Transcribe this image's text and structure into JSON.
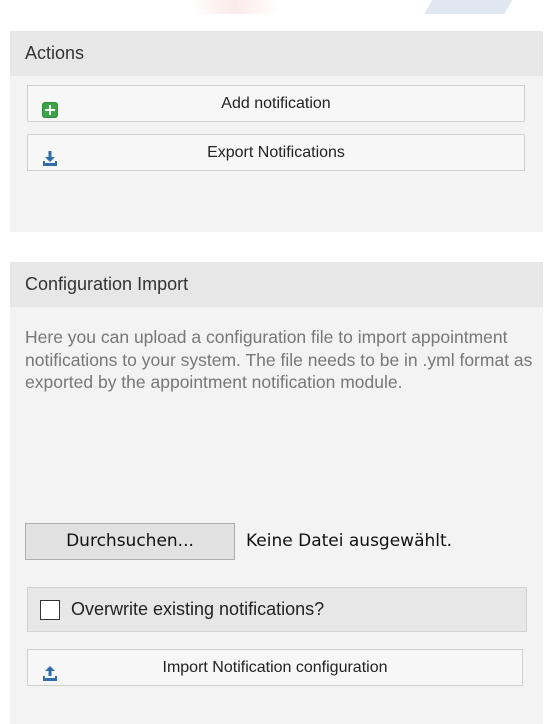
{
  "actions": {
    "title": "Actions",
    "buttons": [
      {
        "label": "Add notification",
        "icon": "plus-square-icon",
        "icon_color": "#3aa547"
      },
      {
        "label": "Export Notifications",
        "icon": "download-icon",
        "icon_color": "#2f6ea8"
      }
    ]
  },
  "import": {
    "title": "Configuration Import",
    "description": "Here you can upload a configuration file to import appointment notifications to your system. The file needs to be in .yml format as exported by the appointment notification module.",
    "browse_label": "Durchsuchen...",
    "file_status": "Keine Datei ausgewählt.",
    "overwrite_label": "Overwrite existing notifications?",
    "overwrite_checked": false,
    "import_button_label": "Import Notification configuration",
    "import_icon": "upload-icon",
    "icon_color": "#2f6ea8"
  }
}
